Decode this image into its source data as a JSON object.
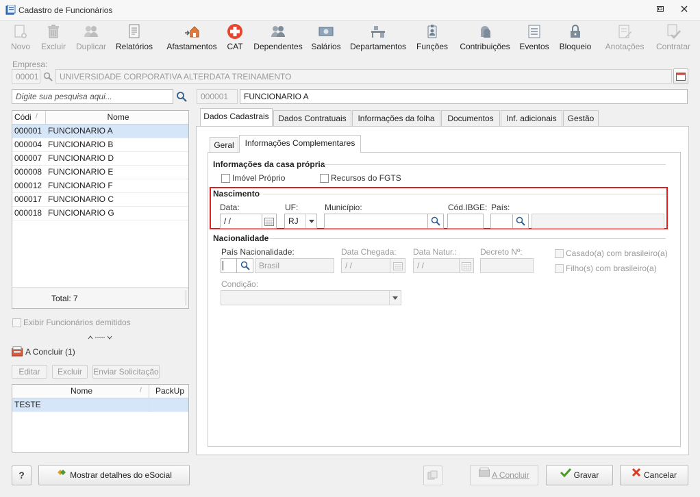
{
  "window": {
    "title": "Cadastro de Funcionários"
  },
  "toolbar": {
    "buttons": [
      {
        "label": "Novo",
        "icon": "new-icon",
        "enabled": false
      },
      {
        "label": "Excluir",
        "icon": "trash-icon",
        "enabled": false
      },
      {
        "label": "Duplicar",
        "icon": "duplicate-users-icon",
        "enabled": false
      },
      {
        "label": "Relatórios",
        "icon": "report-icon",
        "enabled": true
      },
      {
        "label": "Afastamentos",
        "icon": "house-arrow-icon",
        "enabled": true
      },
      {
        "label": "CAT",
        "icon": "medical-cross-icon",
        "enabled": true
      },
      {
        "label": "Dependentes",
        "icon": "users-icon",
        "enabled": true
      },
      {
        "label": "Salários",
        "icon": "money-icon",
        "enabled": true
      },
      {
        "label": "Departamentos",
        "icon": "desk-icon",
        "enabled": true
      },
      {
        "label": "Funções",
        "icon": "badge-icon",
        "enabled": true
      },
      {
        "label": "Contribuições",
        "icon": "heads-icon",
        "enabled": true
      },
      {
        "label": "Eventos",
        "icon": "list-icon",
        "enabled": true
      },
      {
        "label": "Bloqueio",
        "icon": "lock-icon",
        "enabled": true
      },
      {
        "label": "Anotações",
        "icon": "note-icon",
        "enabled": false
      },
      {
        "label": "Contratar",
        "icon": "contract-icon",
        "enabled": false
      }
    ]
  },
  "empresa": {
    "label": "Empresa:",
    "code": "00001",
    "name": "UNIVERSIDADE CORPORATIVA ALTERDATA TREINAMENTO"
  },
  "search": {
    "placeholder": "Digite sua pesquisa aqui..."
  },
  "employee": {
    "code": "000001",
    "name": "FUNCIONARIO A"
  },
  "employee_list": {
    "columns": [
      "Códi",
      "Nome"
    ],
    "rows": [
      {
        "code": "000001",
        "name": "FUNCIONARIO A"
      },
      {
        "code": "000004",
        "name": "FUNCIONARIO B"
      },
      {
        "code": "000007",
        "name": "FUNCIONARIO D"
      },
      {
        "code": "000008",
        "name": "FUNCIONARIO E"
      },
      {
        "code": "000012",
        "name": "FUNCIONARIO F"
      },
      {
        "code": "000017",
        "name": "FUNCIONARIO C"
      },
      {
        "code": "000018",
        "name": "FUNCIONARIO G"
      }
    ],
    "total_label": "Total: 7"
  },
  "exibir_demitidos": "Exibir Funcionários demitidos",
  "a_concluir": {
    "title": "A Concluir (1)",
    "buttons": [
      "Editar",
      "Excluir",
      "Enviar Solicitação"
    ],
    "columns": [
      "Nome",
      "PackUp"
    ],
    "rows": [
      {
        "name": "TESTE",
        "packup": ""
      }
    ]
  },
  "main_tabs": [
    "Dados Cadastrais",
    "Dados Contratuais",
    "Informações da folha",
    "Documentos",
    "Inf. adicionais",
    "Gestão"
  ],
  "sub_tabs": [
    "Geral",
    "Informações Complementares"
  ],
  "casa_propria": {
    "title": "Informações da casa própria",
    "imovel_proprio": "Imóvel Próprio",
    "recursos_fgts": "Recursos do FGTS"
  },
  "nascimento": {
    "title": "Nascimento",
    "data_label": "Data:",
    "data_value": " / /",
    "uf_label": "UF:",
    "uf_value": "RJ",
    "municipio_label": "Município:",
    "cod_ibge_label": "Cód.IBGE:",
    "pais_label": "País:",
    "highlight_color": "#e02020"
  },
  "nacionalidade": {
    "title": "Nacionalidade",
    "pais_label": "País Nacionalidade:",
    "pais_name": "Brasil",
    "data_chegada_label": "Data Chegada:",
    "data_chegada_value": " / /",
    "data_natur_label": "Data Natur.:",
    "data_natur_value": " / /",
    "decreto_label": "Decreto Nº:",
    "casado_label": "Casado(a) com brasileiro(a)",
    "filho_label": "Filho(s) com brasileiro(a)",
    "condicao_label": "Condição:"
  },
  "footer": {
    "help": "?",
    "esocial": "Mostrar detalhes do eSocial",
    "concluir": "A Concluir",
    "gravar": "Gravar",
    "cancelar": "Cancelar"
  }
}
